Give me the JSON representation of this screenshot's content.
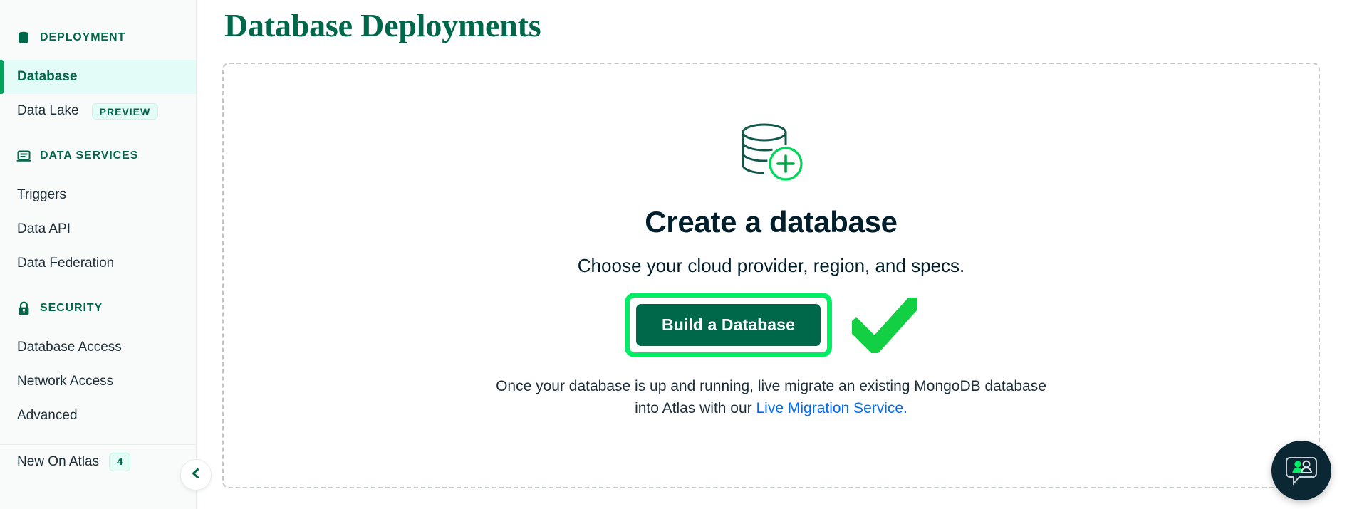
{
  "sidebar": {
    "sections": [
      {
        "icon": "database-icon",
        "label": "DEPLOYMENT",
        "items": [
          {
            "label": "Database",
            "active": true,
            "badge": null
          },
          {
            "label": "Data Lake",
            "active": false,
            "badge": "PREVIEW"
          }
        ]
      },
      {
        "icon": "laptop-icon",
        "label": "DATA SERVICES",
        "items": [
          {
            "label": "Triggers",
            "active": false,
            "badge": null
          },
          {
            "label": "Data API",
            "active": false,
            "badge": null
          },
          {
            "label": "Data Federation",
            "active": false,
            "badge": null
          }
        ]
      },
      {
        "icon": "lock-icon",
        "label": "SECURITY",
        "items": [
          {
            "label": "Database Access",
            "active": false,
            "badge": null
          },
          {
            "label": "Network Access",
            "active": false,
            "badge": null
          },
          {
            "label": "Advanced",
            "active": false,
            "badge": null
          }
        ]
      }
    ],
    "footer_item": {
      "label": "New On Atlas",
      "badge": "4"
    },
    "collapse_icon": "chevron-left-icon"
  },
  "main": {
    "page_title": "Database Deployments",
    "empty_state": {
      "icon": "database-plus-icon",
      "title": "Create a database",
      "subtitle": "Choose your cloud provider, region, and specs.",
      "cta_label": "Build a Database",
      "annotation_check": "checkmark-annotation",
      "footer_line1": "Once your database is up and running, live migrate an existing MongoDB database",
      "footer_line2_prefix": "into Atlas with our ",
      "footer_link": "Live Migration Service."
    }
  },
  "chat": {
    "icon": "chat-people-icon"
  },
  "colors": {
    "brand_green": "#00684A",
    "accent_green": "#00ED64",
    "highlight_green": "#13CF43",
    "mint": "#E3FCF7",
    "link_blue": "#016BF8",
    "navy": "#001E2B",
    "sidebar_bg": "#F9FBFA"
  }
}
